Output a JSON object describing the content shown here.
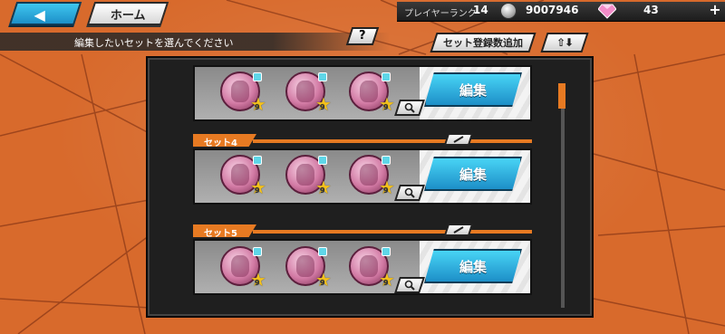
{
  "nav": {
    "back_label": "◀",
    "home_label": "ホーム"
  },
  "status": {
    "rank_label": "プレイヤーランク",
    "rank_value": "14",
    "coins": "9007946",
    "gems": "43",
    "plus_label": "+"
  },
  "header": {
    "instruction": "編集したいセットを選んでください",
    "help_label": "?",
    "add_slots_label": "セット登録数追加",
    "sort_label": "⇧⬇"
  },
  "sets": [
    {
      "name": "",
      "edit_label": "編集",
      "medal_levels": [
        "9",
        "9",
        "9"
      ]
    },
    {
      "name": "セット4",
      "edit_label": "編集",
      "medal_levels": [
        "9",
        "9",
        "9"
      ]
    },
    {
      "name": "セット5",
      "edit_label": "編集",
      "medal_levels": [
        "9",
        "9",
        "9"
      ]
    }
  ],
  "colors": {
    "accent": "#e77a22",
    "button_blue": "#1d8fc8",
    "background": "#d86a2c"
  }
}
